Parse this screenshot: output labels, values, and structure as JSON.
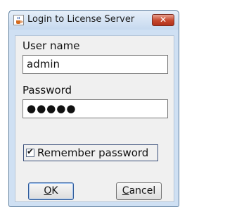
{
  "window": {
    "title": "Login to License Server"
  },
  "form": {
    "username_label": "User name",
    "username_value": "admin",
    "password_label": "Password",
    "password_value": "●●●●●",
    "remember_label": "Remember password",
    "remember_checked": true
  },
  "buttons": {
    "ok_mnemonic": "O",
    "ok_rest": "K",
    "cancel_mnemonic": "C",
    "cancel_rest": "ancel"
  },
  "colors": {
    "close_button": "#c6452b",
    "window_frame": "#cfe0f3"
  },
  "icons": {
    "title_icon": "java-coffee-cup-icon",
    "close": "close-icon"
  }
}
